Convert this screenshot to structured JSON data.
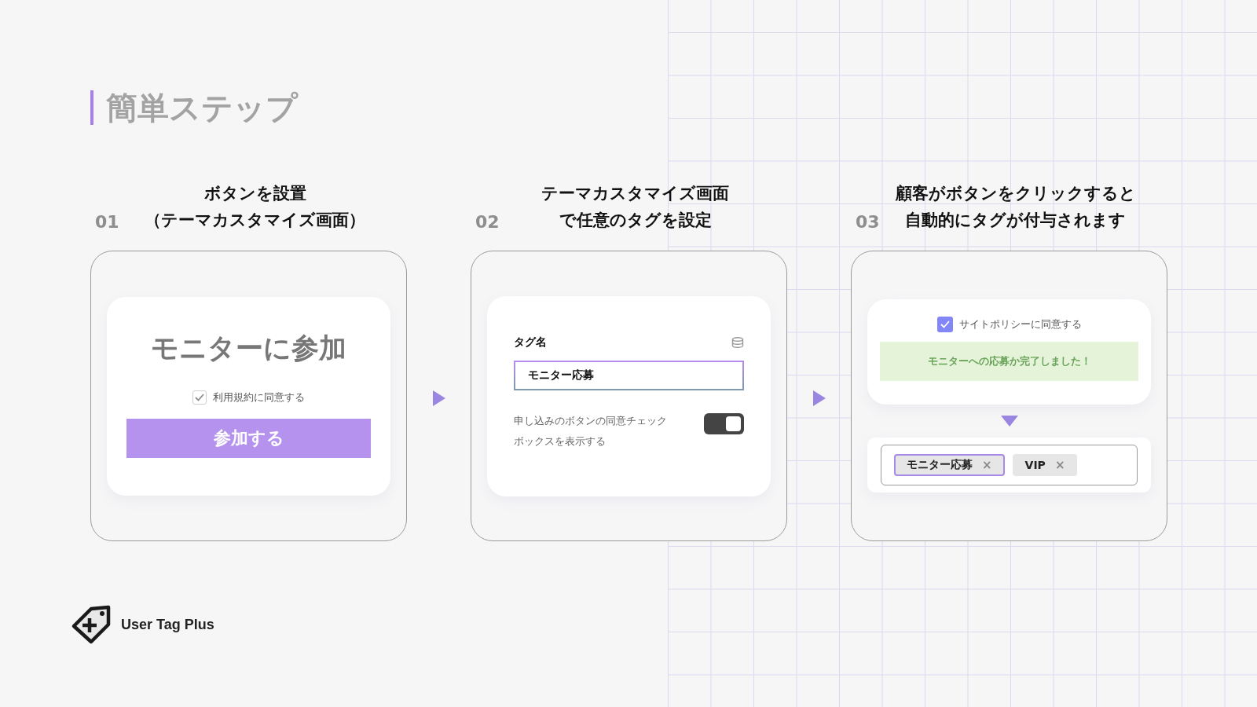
{
  "section_title": "簡単ステップ",
  "steps": [
    {
      "kind": "signup",
      "number": "01",
      "title_lines": [
        "ボタンを設置",
        "（テーマカスタマイズ画面）"
      ],
      "heading": "モニターに参加",
      "checkbox": {
        "label": "利用規約に同意する",
        "checked": true
      },
      "button": "参加する"
    },
    {
      "kind": "settings",
      "number": "02",
      "title_lines": [
        "テーマカスタマイズ画面",
        "で任意のタグを設定"
      ],
      "field_label": "タグ名",
      "field_value": "モニター応募",
      "toggle": {
        "label": "申し込みのボタンの同意チェックボックスを表示する",
        "on": true
      }
    },
    {
      "kind": "result",
      "number": "03",
      "title_lines": [
        "顧客がボタンをクリックすると",
        "自動的にタグが付与されます"
      ],
      "checkbox": {
        "label": "サイトポリシーに同意する",
        "checked": true
      },
      "message": "モニターへの応募か完了しました！",
      "tags": [
        {
          "label": "モニター応募",
          "remove": "×",
          "selected": true
        },
        {
          "label": "VIP",
          "remove": "×",
          "selected": false
        }
      ]
    }
  ],
  "brand": "User Tag Plus"
}
